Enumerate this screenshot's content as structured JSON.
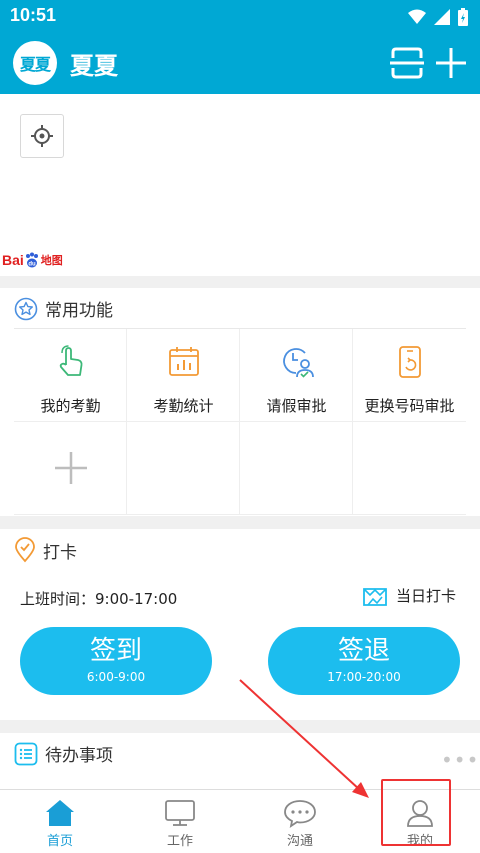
{
  "status_bar": {
    "time": "10:51"
  },
  "header": {
    "avatar_text": "夏夏",
    "user_name": "夏夏"
  },
  "map": {
    "logo_bai": "Bai",
    "logo_di": "地图"
  },
  "common": {
    "title": "常用功能",
    "items": [
      {
        "label": "我的考勤",
        "icon": "touch-icon"
      },
      {
        "label": "考勤统计",
        "icon": "calendar-chart-icon"
      },
      {
        "label": "请假审批",
        "icon": "clock-user-icon"
      },
      {
        "label": "更换号码审批",
        "icon": "phone-icon"
      }
    ],
    "add_icon": "plus-icon"
  },
  "clock": {
    "title": "打卡",
    "shift_label": "上班时间：9:00-17:00",
    "today_label": "当日打卡",
    "checkin": {
      "label": "签到",
      "time": "6:00-9:00"
    },
    "checkout": {
      "label": "签退",
      "time": "17:00-20:00"
    }
  },
  "todo": {
    "title": "待办事项",
    "more": "•••"
  },
  "tabs": [
    {
      "label": "首页",
      "icon": "home-icon",
      "active": true
    },
    {
      "label": "工作",
      "icon": "monitor-icon",
      "active": false
    },
    {
      "label": "沟通",
      "icon": "chat-icon",
      "active": false
    },
    {
      "label": "我的",
      "icon": "user-icon",
      "active": false
    }
  ],
  "colors": {
    "brand": "#00a8d4",
    "button": "#1cbdee",
    "highlight": "#e33333"
  }
}
